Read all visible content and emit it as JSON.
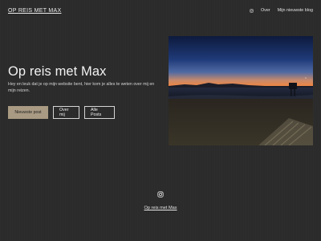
{
  "header": {
    "site_title": "OP REIS MET MAX",
    "nav": {
      "instagram_icon": "instagram-icon",
      "items": [
        {
          "label": "Over"
        },
        {
          "label": "Mijn nieuwste blog"
        }
      ]
    }
  },
  "hero": {
    "title": "Op reis met Max",
    "description": "Hey en leuk dat je op mijn website bent, hier kom je alles te weten over mij en mijn reizen.",
    "buttons": [
      {
        "label": "Nieuwste post"
      },
      {
        "label": "Over mij"
      },
      {
        "label": "Alle Posts"
      }
    ],
    "image_alt_icon": "beach-sunset-photo"
  },
  "footer": {
    "instagram_icon": "instagram-icon",
    "title": "Op reis met Max"
  },
  "colors": {
    "background": "#2b2b2b",
    "primary_button": "#a99a83",
    "text": "#e6e6e6"
  }
}
